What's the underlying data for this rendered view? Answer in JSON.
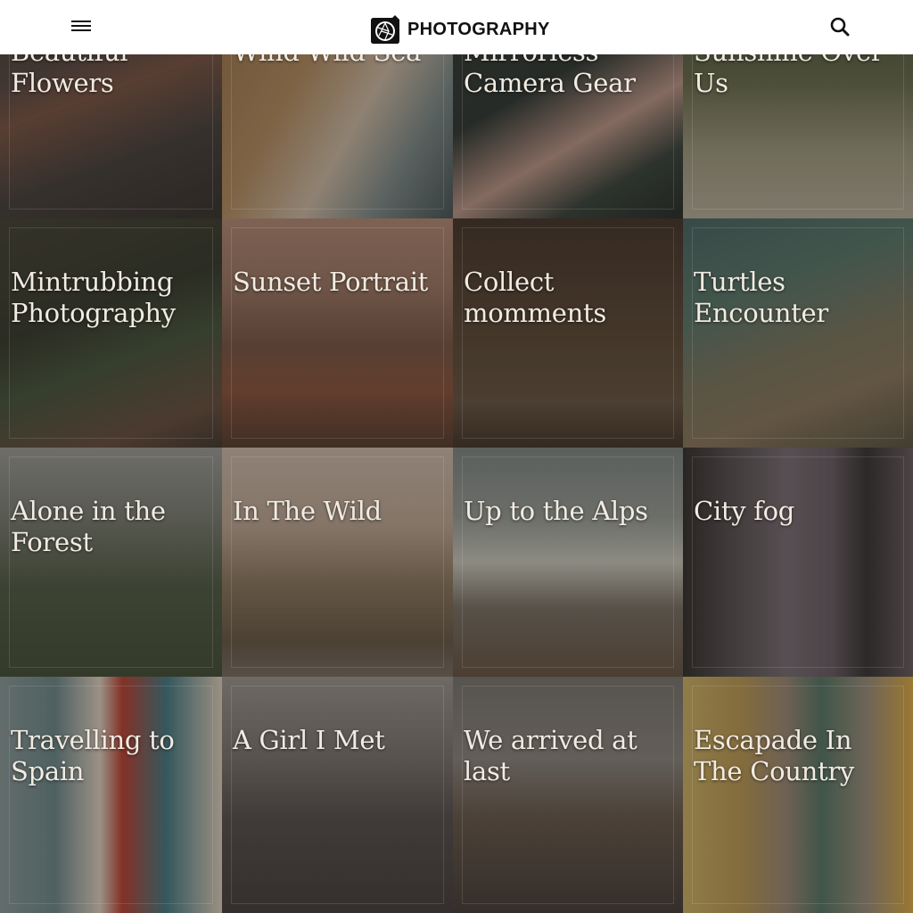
{
  "header": {
    "logo_text": "PHOTOGRAPHY",
    "menu_icon": "hamburger-menu-icon",
    "search_icon": "search-icon",
    "background": "#ffffff"
  },
  "tiles": [
    {
      "title": "Beautiful Flowers"
    },
    {
      "title": "Wind Wild Sea"
    },
    {
      "title": "Mirrorless Camera Gear"
    },
    {
      "title": "Sunshine Over Us"
    },
    {
      "title": "Mintrubbing Photography"
    },
    {
      "title": "Sunset Portrait"
    },
    {
      "title": "Collect momments"
    },
    {
      "title": "Turtles Encounter"
    },
    {
      "title": "Alone in the Forest"
    },
    {
      "title": "In The Wild"
    },
    {
      "title": "Up to the Alps"
    },
    {
      "title": "City fog"
    },
    {
      "title": "Travelling to Spain"
    },
    {
      "title": "A Girl I Met"
    },
    {
      "title": "We arrived at last"
    },
    {
      "title": "Escapade In The Country"
    }
  ]
}
